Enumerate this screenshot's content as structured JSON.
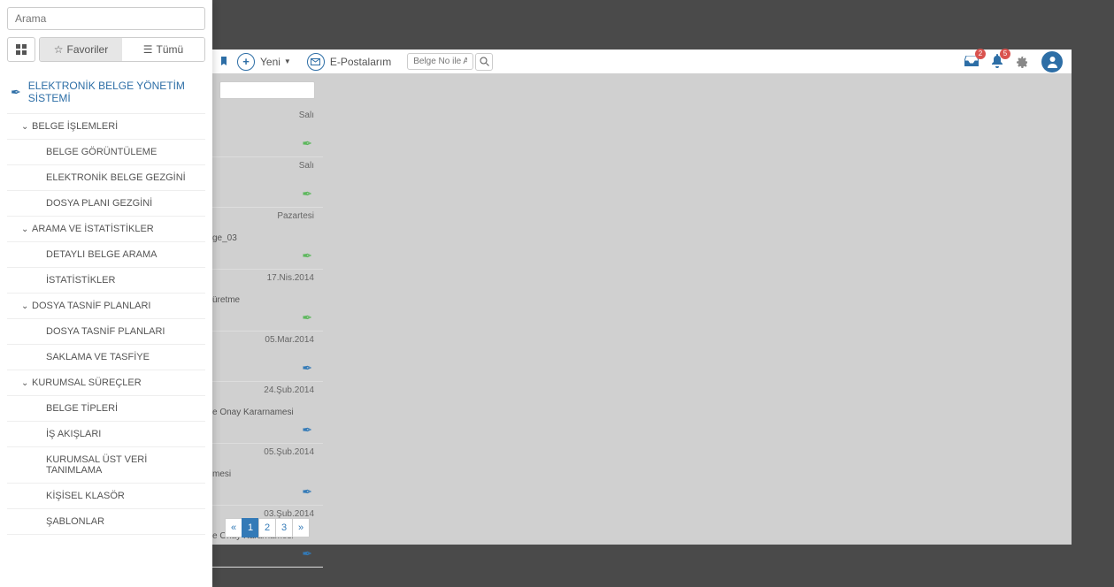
{
  "sidebar": {
    "search_placeholder": "Arama",
    "tabs": {
      "favorites": "Favoriler",
      "all": "Tümü"
    },
    "heading": "ELEKTRONİK BELGE YÖNETİM SİSTEMİ",
    "sections": [
      {
        "label": "BELGE İŞLEMLERİ",
        "items": [
          "BELGE GÖRÜNTÜLEME",
          "ELEKTRONİK BELGE GEZGİNİ",
          "DOSYA PLANI GEZGİNİ"
        ]
      },
      {
        "label": "ARAMA VE İSTATİSTİKLER",
        "items": [
          "DETAYLI BELGE ARAMA",
          "İSTATİSTİKLER"
        ]
      },
      {
        "label": "DOSYA TASNİF PLANLARI",
        "items": [
          "DOSYA TASNİF PLANLARI",
          "SAKLAMA VE TASFİYE"
        ]
      },
      {
        "label": "KURUMSAL SÜREÇLER",
        "items": [
          "BELGE TİPLERİ",
          "İŞ AKIŞLARI",
          "KURUMSAL ÜST VERİ TANIMLAMA",
          "KİŞİSEL KLASÖR",
          "ŞABLONLAR"
        ]
      }
    ]
  },
  "toolbar": {
    "new_label": "Yeni",
    "mail_label": "E-Postalarım",
    "doc_search_placeholder": "Belge No ile Ara",
    "inbox_badge": "2",
    "bell_badge": "5"
  },
  "list": {
    "rows": [
      {
        "date": "Salı",
        "title": "",
        "pen": "green"
      },
      {
        "date": "Salı",
        "title": "",
        "pen": "green"
      },
      {
        "date": "Pazartesi",
        "title": "ge_03",
        "pen": "green"
      },
      {
        "date": "17.Nis.2014",
        "title": "üretme",
        "pen": "green"
      },
      {
        "date": "05.Mar.2014",
        "title": "",
        "pen": "blue"
      },
      {
        "date": "24.Şub.2014",
        "title": "e Onay Kararnamesi",
        "pen": "blue"
      },
      {
        "date": "05.Şub.2014",
        "title": "mesi",
        "pen": "blue"
      },
      {
        "date": "03.Şub.2014",
        "title": "e Onay Kararnamesi",
        "pen": "blue"
      }
    ]
  },
  "pager": {
    "prev": "«",
    "p1": "1",
    "p2": "2",
    "p3": "3",
    "next": "»"
  }
}
